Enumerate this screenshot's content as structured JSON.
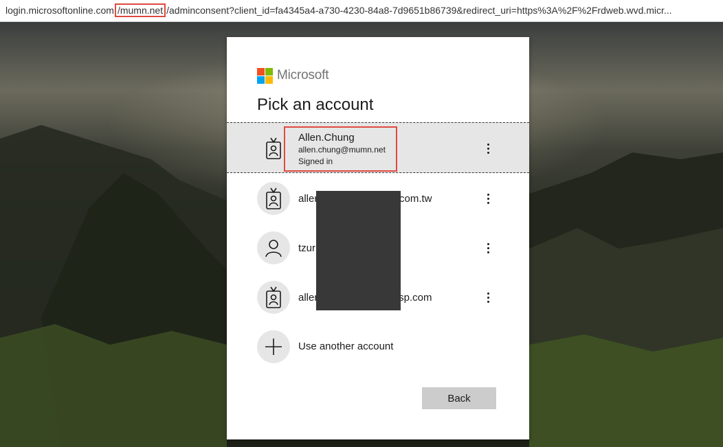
{
  "browser": {
    "url_prefix": "login.microsoftonline.com",
    "url_highlight": "/mumn.net",
    "url_suffix": "/adminconsent?client_id=fa4345a4-a730-4230-84a8-7d9651b86739&redirect_uri=https%3A%2F%2Frdweb.wvd.micr..."
  },
  "brand": {
    "name": "Microsoft"
  },
  "heading": "Pick an account",
  "accounts": [
    {
      "name": "Allen.Chung",
      "email": "allen.chung@mumn.net",
      "status": "Signed in",
      "icon": "badge-icon"
    },
    {
      "label_visible_left": "aller",
      "label_visible_right": "com.tw",
      "icon": "badge-icon"
    },
    {
      "label_visible_left": "tzur",
      "icon": "person-icon"
    },
    {
      "label_visible_left": "aller",
      "label_visible_right": "tsp.com",
      "icon": "badge-icon"
    }
  ],
  "use_another": "Use another account",
  "back_label": "Back",
  "colors": {
    "highlight": "#e04a3f",
    "ms_red": "#f25022",
    "ms_green": "#7fba00",
    "ms_blue": "#00a4ef",
    "ms_yellow": "#ffb900"
  }
}
